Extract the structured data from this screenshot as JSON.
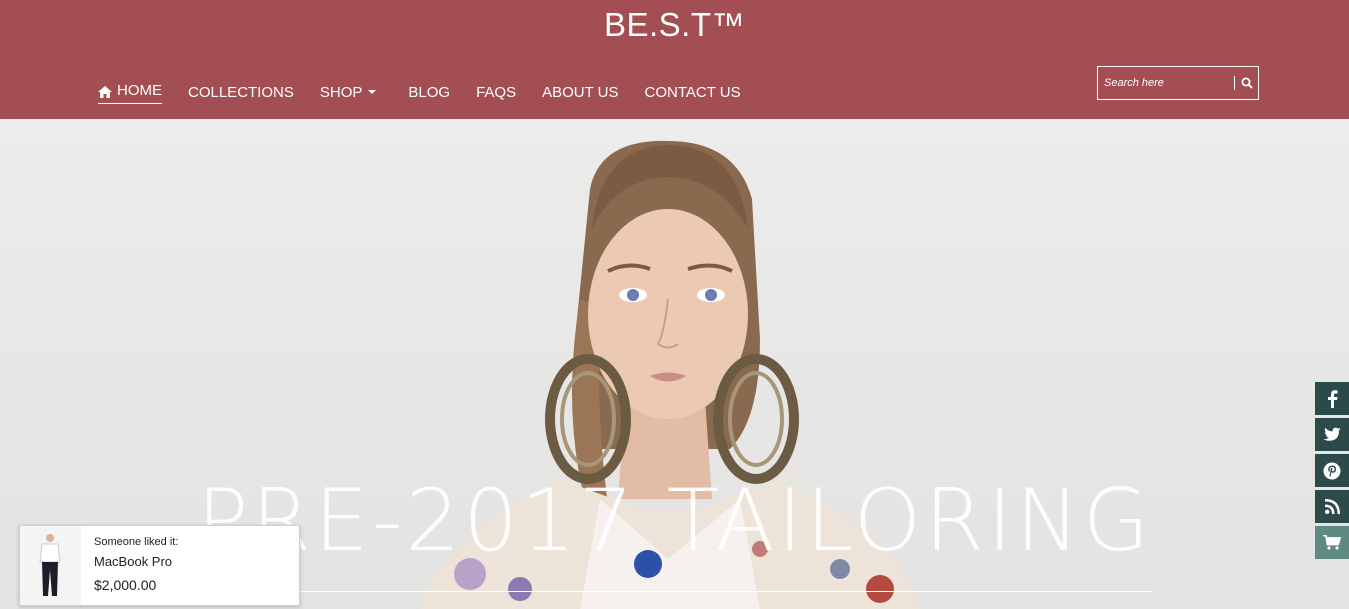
{
  "header": {
    "brand": "BE.S.T™",
    "nav": [
      {
        "label": "HOME",
        "icon": "home-icon",
        "active": true
      },
      {
        "label": "COLLECTIONS"
      },
      {
        "label": "SHOP",
        "has_dropdown": true
      },
      {
        "label": "BLOG"
      },
      {
        "label": "FAQS"
      },
      {
        "label": "ABOUT US"
      },
      {
        "label": "CONTACT US"
      }
    ],
    "search": {
      "placeholder": "Search here",
      "icon": "search-icon"
    },
    "background": "#a24e53"
  },
  "hero": {
    "title": "PRE-2017 TAILORING"
  },
  "social": [
    {
      "icon": "facebook-icon"
    },
    {
      "icon": "twitter-icon"
    },
    {
      "icon": "pinterest-icon"
    },
    {
      "icon": "rss-icon"
    },
    {
      "icon": "cart-icon"
    }
  ],
  "popup": {
    "note": "Someone liked it:",
    "product": "MacBook Pro",
    "price": "$2,000.00"
  }
}
